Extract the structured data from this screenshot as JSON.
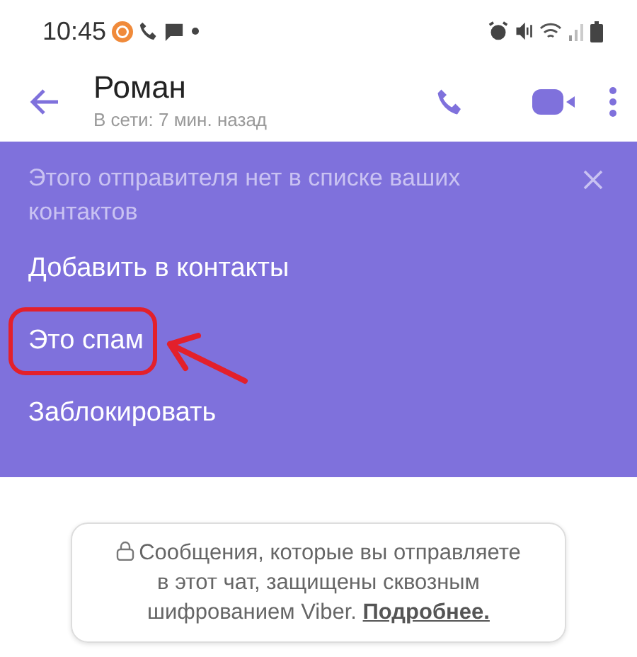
{
  "status_bar": {
    "time": "10:45"
  },
  "header": {
    "name": "Роман",
    "presence": "В сети: 7 мин. назад"
  },
  "banner": {
    "message": "Этого отправителя нет в списке ваших контактов",
    "actions": [
      {
        "label": "Добавить в контакты",
        "highlighted": false
      },
      {
        "label": "Это спам",
        "highlighted": true
      },
      {
        "label": "Заблокировать",
        "highlighted": false
      }
    ]
  },
  "notice": {
    "text": "Сообщения, которые вы отправляете в этот чат, защищены сквозным шифрованием Viber.",
    "link": "Подробнее."
  }
}
